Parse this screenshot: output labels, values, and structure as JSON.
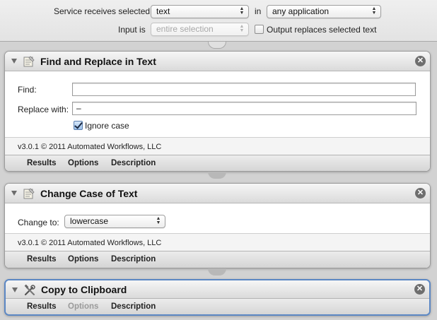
{
  "service_bar": {
    "receives_label": "Service receives selected",
    "receives_value": "text",
    "in_label": "in",
    "app_value": "any application",
    "input_is_label": "Input is",
    "input_is_value": "entire selection",
    "output_replaces_label": "Output replaces selected text",
    "output_replaces_checked": false
  },
  "actions": [
    {
      "title": "Find and Replace in Text",
      "icon": "text-document-icon",
      "find_label": "Find:",
      "find_value": "",
      "replace_label": "Replace with:",
      "replace_value": "–",
      "ignore_case_label": "Ignore case",
      "ignore_case_checked": true,
      "version": "v3.0.1 © 2011 Automated Workflows, LLC",
      "tabs": [
        "Results",
        "Options",
        "Description"
      ]
    },
    {
      "title": "Change Case of Text",
      "icon": "text-document-icon",
      "change_to_label": "Change to:",
      "change_to_value": "lowercase",
      "version": "v3.0.1 © 2011 Automated Workflows, LLC",
      "tabs": [
        "Results",
        "Options",
        "Description"
      ]
    },
    {
      "title": "Copy to Clipboard",
      "icon": "tools-icon",
      "tabs": [
        "Results",
        "Options",
        "Description"
      ],
      "options_disabled": true
    }
  ],
  "colors": {
    "selection_border": "#5b87c4",
    "close_button": "#6e6e6e",
    "background": "#d2d2d2"
  }
}
